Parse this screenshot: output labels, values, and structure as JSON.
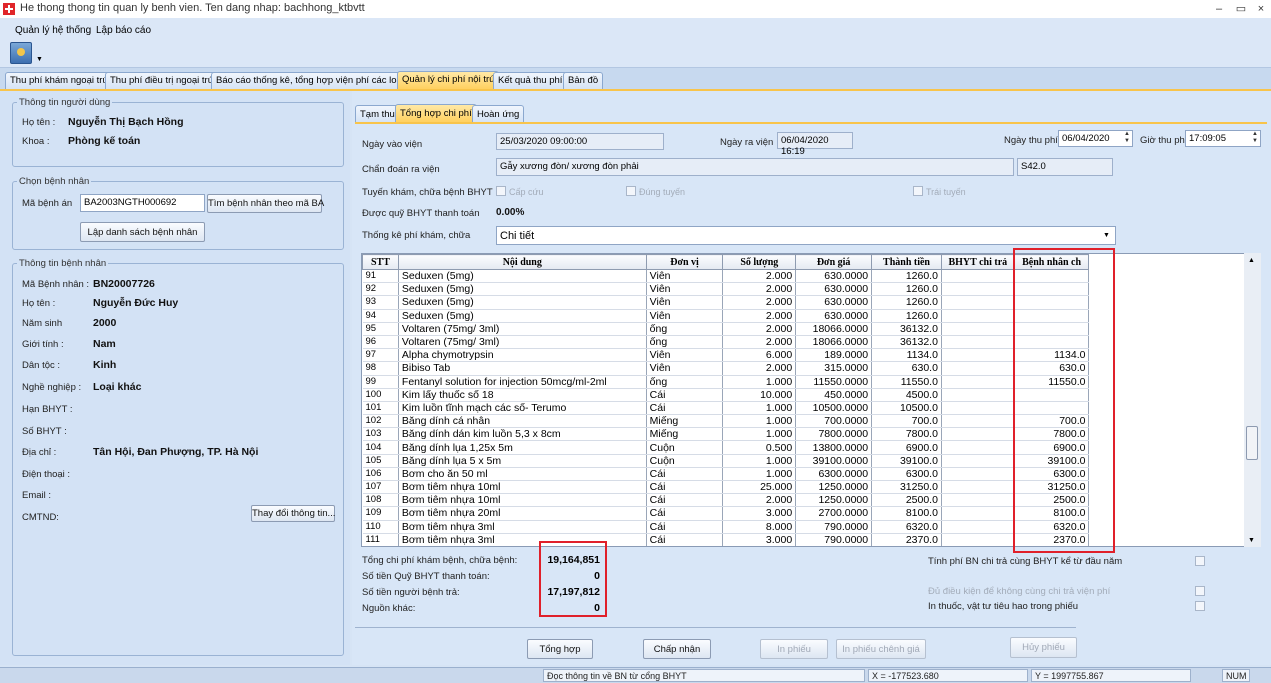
{
  "window": {
    "title": "He thong thong tin quan ly benh vien. Ten dang nhap: bachhong_ktbvtt",
    "minimize": "–",
    "restore": "▭",
    "close": "×"
  },
  "menu": [
    "Quản lý hệ thống",
    "Lập báo cáo"
  ],
  "main_tabs": [
    "Thu phí khám ngoại trú",
    "Thu phí điều trị ngoại trú",
    "Báo cáo thống kê, tổng hợp viện phí các loại",
    "Quản lý chi phí nội trú",
    "Kết quả thu phí",
    "Bản đồ"
  ],
  "user_info": {
    "legend": "Thông tin người dùng",
    "name_label": "Họ tên :",
    "name": "Nguyễn Thị Bạch Hồng",
    "dept_label": "Khoa :",
    "dept": "Phòng kế toán"
  },
  "select_patient": {
    "legend": "Chọn bệnh nhân",
    "record_label": "Mã bệnh án",
    "record_value": "BA2003NGTH000692",
    "search_button": "Tìm bệnh nhân theo mã BA",
    "list_button": "Lập danh sách bệnh nhân"
  },
  "patient_info": {
    "legend": "Thông tin bệnh nhân",
    "fields": [
      {
        "label": "Mã Bệnh nhân :",
        "value": "BN20007726"
      },
      {
        "label": "Họ tên :",
        "value": "Nguyễn Đức Huy"
      },
      {
        "label": "Năm sinh",
        "value": "2000"
      },
      {
        "label": "Giới tính :",
        "value": "Nam"
      },
      {
        "label": "Dân tộc :",
        "value": "Kinh"
      },
      {
        "label": "Nghề nghiệp :",
        "value": "Loại khác"
      },
      {
        "label": "Hạn BHYT :",
        "value": ""
      },
      {
        "label": "Số BHYT :",
        "value": ""
      },
      {
        "label": "Địa chỉ :",
        "value": "Tân Hội, Đan Phượng, TP. Hà Nội"
      },
      {
        "label": "Điện thoại :",
        "value": ""
      },
      {
        "label": "Email :",
        "value": ""
      },
      {
        "label": "CMTND:",
        "value": ""
      }
    ],
    "change_button": "Thay đổi thông tin..."
  },
  "sub_tabs": [
    "Tạm thu",
    "Tổng hợp chi phí",
    "Hoàn ứng"
  ],
  "admission": {
    "admit_label": "Ngày vào viện",
    "admit_value": "25/03/2020 09:00:00",
    "discharge_label": "Ngày ra viện",
    "discharge_value": "06/04/2020 16:19",
    "pay_date_label": "Ngày thu phí",
    "pay_date_value": "06/04/2020",
    "pay_time_label": "Giờ thu phí",
    "pay_time_value": "17:09:05",
    "diagnosis_label": "Chẩn đoán ra viện",
    "diagnosis_value": "Gẫy xương đòn/ xương đòn phải",
    "diagnosis_code": "S42.0",
    "route_label": "Tuyến khám, chữa bệnh BHYT",
    "emergency": "Cấp cứu",
    "correct_route": "Đúng tuyến",
    "wrong_route": "Trái tuyến",
    "coverage_label": "Được quỹ BHYT thanh toán",
    "coverage_value": "0.00%",
    "stat_label": "Thống kê phí khám, chữa",
    "stat_value": "Chi tiết"
  },
  "grid": {
    "columns": [
      "STT",
      "Nội dung",
      "Đơn vị",
      "Số lượng",
      "Đơn giá",
      "Thành tiền",
      "BHYT chi trả",
      "Bệnh nhân ch"
    ],
    "rows": [
      [
        "91",
        "Seduxen (5mg)",
        "Viên",
        "2.000",
        "630.0000",
        "1260.0",
        "",
        ""
      ],
      [
        "92",
        "Seduxen (5mg)",
        "Viên",
        "2.000",
        "630.0000",
        "1260.0",
        "",
        ""
      ],
      [
        "93",
        "Seduxen (5mg)",
        "Viên",
        "2.000",
        "630.0000",
        "1260.0",
        "",
        ""
      ],
      [
        "94",
        "Seduxen (5mg)",
        "Viên",
        "2.000",
        "630.0000",
        "1260.0",
        "",
        ""
      ],
      [
        "95",
        "Voltaren (75mg/ 3ml)",
        "ống",
        "2.000",
        "18066.0000",
        "36132.0",
        "",
        ""
      ],
      [
        "96",
        "Voltaren (75mg/ 3ml)",
        "ống",
        "2.000",
        "18066.0000",
        "36132.0",
        "",
        ""
      ],
      [
        "97",
        "Alpha chymotrypsin",
        "Viên",
        "6.000",
        "189.0000",
        "1134.0",
        "",
        "1134.0"
      ],
      [
        "98",
        "Bibiso Tab",
        "Viên",
        "2.000",
        "315.0000",
        "630.0",
        "",
        "630.0"
      ],
      [
        "99",
        "Fentanyl solution for injection 50mcg/ml-2ml",
        "ống",
        "1.000",
        "11550.0000",
        "11550.0",
        "",
        "11550.0"
      ],
      [
        "100",
        "Kim lấy thuốc số 18",
        "Cái",
        "10.000",
        "450.0000",
        "4500.0",
        "",
        ""
      ],
      [
        "101",
        "Kim luồn tĩnh mạch các số- Terumo",
        "Cái",
        "1.000",
        "10500.0000",
        "10500.0",
        "",
        ""
      ],
      [
        "102",
        "Băng dính cá nhân",
        "Miếng",
        "1.000",
        "700.0000",
        "700.0",
        "",
        "700.0"
      ],
      [
        "103",
        "Băng dính dán kim luồn 5,3 x 8cm",
        "Miếng",
        "1.000",
        "7800.0000",
        "7800.0",
        "",
        "7800.0"
      ],
      [
        "104",
        "Băng dính lụa 1,25x 5m",
        "Cuộn",
        "0.500",
        "13800.0000",
        "6900.0",
        "",
        "6900.0"
      ],
      [
        "105",
        "Băng dính lụa 5 x 5m",
        "Cuộn",
        "1.000",
        "39100.0000",
        "39100.0",
        "",
        "39100.0"
      ],
      [
        "106",
        "Bơm cho ăn 50 ml",
        "Cái",
        "1.000",
        "6300.0000",
        "6300.0",
        "",
        "6300.0"
      ],
      [
        "107",
        "Bơm tiêm nhựa 10ml",
        "Cái",
        "25.000",
        "1250.0000",
        "31250.0",
        "",
        "31250.0"
      ],
      [
        "108",
        "Bơm tiêm nhựa 10ml",
        "Cái",
        "2.000",
        "1250.0000",
        "2500.0",
        "",
        "2500.0"
      ],
      [
        "109",
        "Bơm tiêm nhựa 20ml",
        "Cái",
        "3.000",
        "2700.0000",
        "8100.0",
        "",
        "8100.0"
      ],
      [
        "110",
        "Bơm tiêm nhựa 3ml",
        "Cái",
        "8.000",
        "790.0000",
        "6320.0",
        "",
        "6320.0"
      ],
      [
        "111",
        "Bơm tiêm nhựa 3ml",
        "Cái",
        "3.000",
        "790.0000",
        "2370.0",
        "",
        "2370.0"
      ]
    ]
  },
  "summary": {
    "total_label": "Tổng chi phí khám bệnh, chữa bệnh:",
    "total_value": "19,164,851",
    "fund_label": "Số tiền Quỹ BHYT thanh toán:",
    "fund_value": "0",
    "patient_label": "Số tiền người bệnh trả:",
    "patient_value": "17,197,812",
    "other_label": "Nguồn khác:",
    "other_value": "0",
    "opt1": "Tính phí BN chi trả cùng BHYT kể từ đầu năm",
    "opt2": "Đủ điều kiện để không cùng chi trả viện phí",
    "opt3": "In thuốc, vật tư tiêu hao trong phiếu"
  },
  "actions": [
    "Tổng hợp",
    "Chấp nhận",
    "In phiếu",
    "In phiếu chênh giá",
    "Hủy phiếu"
  ],
  "status": {
    "message": "Đọc thông tin về BN từ cổng BHYT",
    "x": "X = -177523.680",
    "y": "Y = 1997755.867",
    "num": "NUM"
  }
}
